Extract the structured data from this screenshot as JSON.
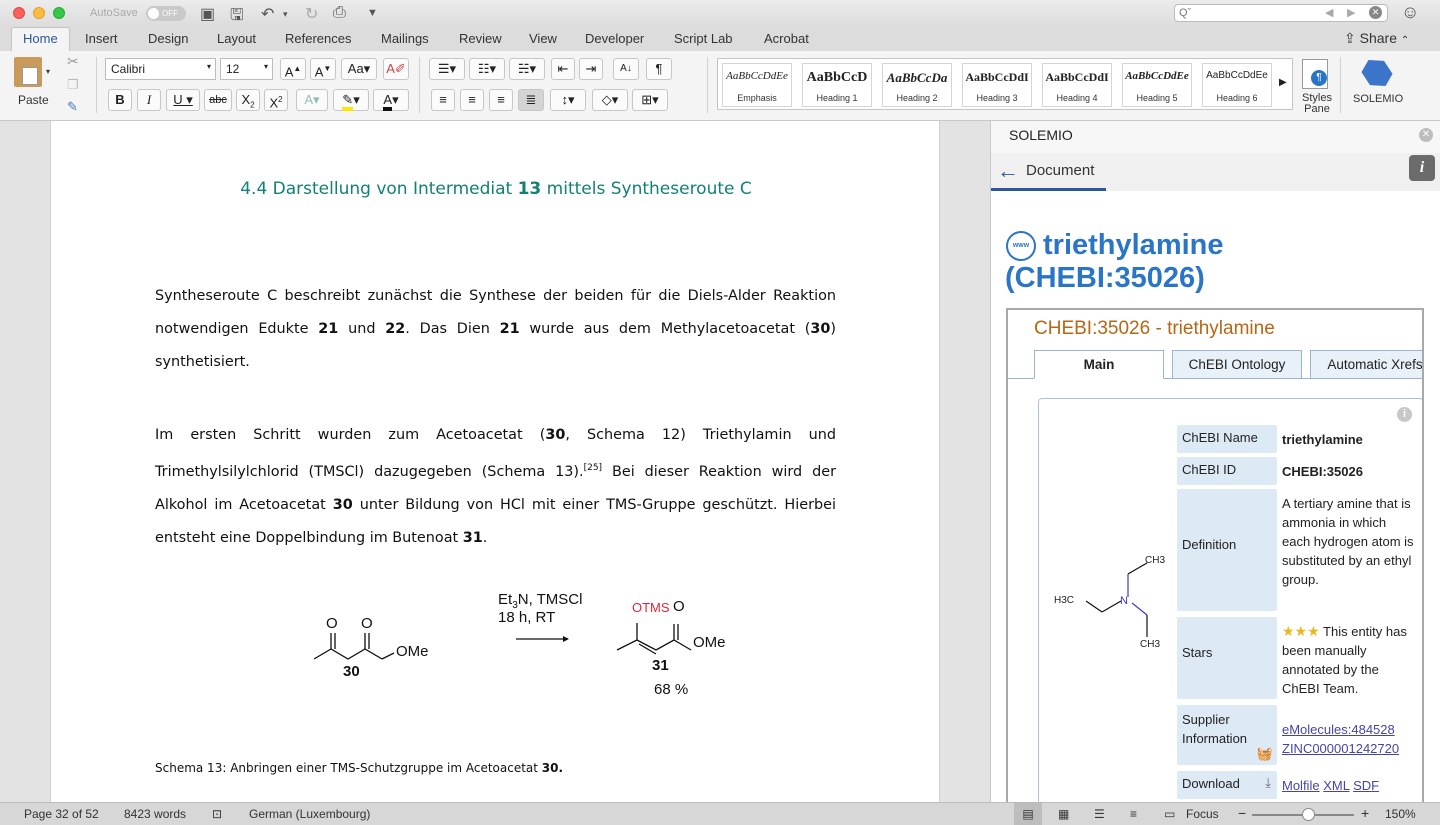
{
  "titlebar": {
    "autosave_label": "AutoSave",
    "autosave_state": "OFF",
    "search_placeholder": "Qˇ"
  },
  "tabs": [
    "Home",
    "Insert",
    "Design",
    "Layout",
    "References",
    "Mailings",
    "Review",
    "View",
    "Developer",
    "Script Lab",
    "Acrobat"
  ],
  "share_label": "Share",
  "ribbon": {
    "paste_label": "Paste",
    "font_name": "Calibri",
    "font_size": "12",
    "styles": [
      {
        "sample": "AaBbCcDdEe",
        "name": "Emphasis"
      },
      {
        "sample": "AaBbCcD",
        "name": "Heading 1"
      },
      {
        "sample": "AaBbCcDa",
        "name": "Heading 2"
      },
      {
        "sample": "AaBbCcDdI",
        "name": "Heading 3"
      },
      {
        "sample": "AaBbCcDdI",
        "name": "Heading 4"
      },
      {
        "sample": "AaBbCcDdEe",
        "name": "Heading 5"
      },
      {
        "sample": "AaBbCcDdEe",
        "name": "Heading 6"
      }
    ],
    "styles_pane_label": "Styles Pane",
    "solemio_label": "SOLEMIO"
  },
  "document": {
    "heading_pre": "4.4 Darstellung von Intermediat ",
    "heading_num": "13",
    "heading_post": " mittels Syntheseroute C",
    "scheme": {
      "reagents_line1": "Et3N, TMSCl",
      "reagents_line2": "18 h, RT",
      "sm_number": "30",
      "sm_ester": "OMe",
      "sm_o1": "O",
      "sm_o2": "O",
      "product_otms": "OTMS",
      "product_o": "O",
      "product_ester": "OMe",
      "product_number": "31",
      "yield": "68 %"
    },
    "caption_text": "Schema 13: Anbringen einer TMS-Schutzgruppe im Acetoacetat ",
    "caption_num": "30."
  },
  "pane": {
    "title": "SOLEMIO",
    "nav_label": "Document",
    "entity_title": "triethylamine (CHEBI:35026)",
    "chebi_header": "CHEBI:35026 - triethylamine",
    "chebi_tabs": [
      "Main",
      "ChEBI Ontology",
      "Automatic Xrefs"
    ],
    "rows": {
      "name_label": "ChEBI Name",
      "name_value": "triethylamine",
      "id_label": "ChEBI ID",
      "id_value": "CHEBI:35026",
      "definition_label": "Definition",
      "definition_value": "A tertiary amine that is ammonia in which each hydrogen atom is substituted by an ethyl group.",
      "stars_label": "Stars",
      "stars_value": "This entity has been manually annotated by the ChEBI Team.",
      "supplier_label": "Supplier Information",
      "supplier_link1": "eMolecules:484528",
      "supplier_link2": "ZINC000001242720",
      "download_label": "Download",
      "download_links": [
        "Molfile",
        "XML",
        "SDF"
      ]
    },
    "structure_labels": {
      "ch3_top": "CH3",
      "h3c": "H3C",
      "n": "N",
      "ch3_bottom": "CH3"
    }
  },
  "statusbar": {
    "page": "Page 32 of 52",
    "words": "8423 words",
    "language": "German (Luxembourg)",
    "focus": "Focus",
    "zoom": "150%"
  },
  "colors": {
    "heading": "#138077",
    "pane_title": "#2a75c8",
    "chebi_header": "#b56715",
    "accent": "#2b579a"
  }
}
